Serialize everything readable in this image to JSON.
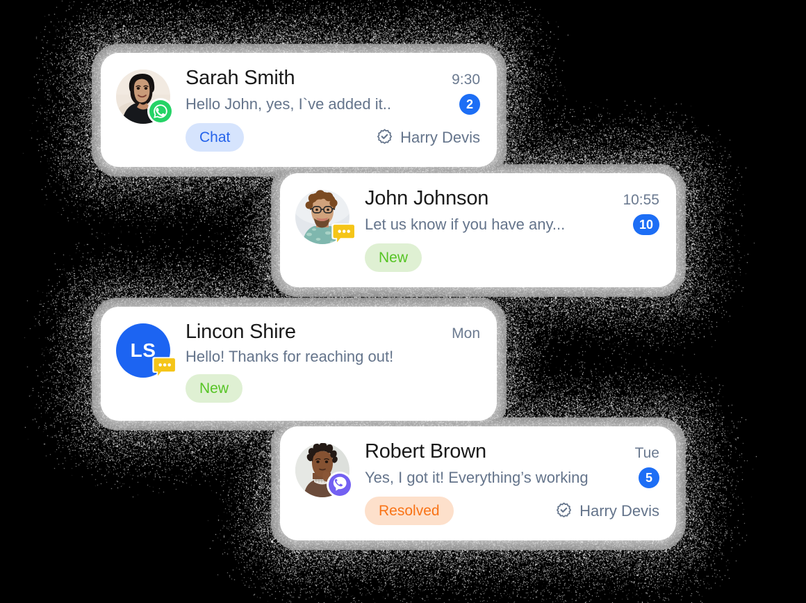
{
  "background": {
    "color": "#000000",
    "effect": "dithered-noise-glow"
  },
  "palette": {
    "card_bg": "#FFFFFF",
    "name_color": "#1A1A1A",
    "preview_color": "#64748B",
    "time_color": "#6B7A90",
    "badge_blue": "#1D6EF5",
    "avatar_blue": "#1C64F2",
    "whatsapp_green": "#25D366",
    "viber_purple": "#7360F2",
    "chat_yellow": "#F5C518",
    "tag_chat_bg": "#D6E4FD",
    "tag_chat_text": "#2563EB",
    "tag_new_bg": "#DFF0D3",
    "tag_new_text": "#56C424",
    "tag_resolved_bg": "#FDE0CB",
    "tag_resolved_text": "#F97316"
  },
  "conversations": [
    {
      "id": "sarah-smith",
      "name": "Sarah Smith",
      "time": "9:30",
      "preview": "Hello John, yes, I`ve added it..",
      "unread": "2",
      "tag": {
        "label": "Chat",
        "style": "chat"
      },
      "assignee": "Harry Devis",
      "has_assignee": true,
      "avatar_type": "photo-woman",
      "channel_icon": "whatsapp-icon"
    },
    {
      "id": "john-johnson",
      "name": "John Johnson",
      "time": "10:55",
      "preview": "Let us know if you have any...",
      "unread": "10",
      "tag": {
        "label": "New",
        "style": "new"
      },
      "assignee": "",
      "has_assignee": false,
      "avatar_type": "photo-man-glasses",
      "channel_icon": "chat-bubble-icon"
    },
    {
      "id": "lincon-shire",
      "name": "Lincon Shire",
      "time": "Mon",
      "preview": "Hello! Thanks for reaching out!",
      "unread": "",
      "tag": {
        "label": "New",
        "style": "new"
      },
      "assignee": "",
      "has_assignee": false,
      "avatar_type": "initials",
      "avatar_initials": "LS",
      "channel_icon": "chat-bubble-icon"
    },
    {
      "id": "robert-brown",
      "name": "Robert Brown",
      "time": "Tue",
      "preview": "Yes, I got it! Everything’s working",
      "unread": "5",
      "tag": {
        "label": "Resolved",
        "style": "resolved"
      },
      "assignee": "Harry Devis",
      "has_assignee": true,
      "avatar_type": "photo-man-locs",
      "channel_icon": "viber-icon"
    }
  ]
}
